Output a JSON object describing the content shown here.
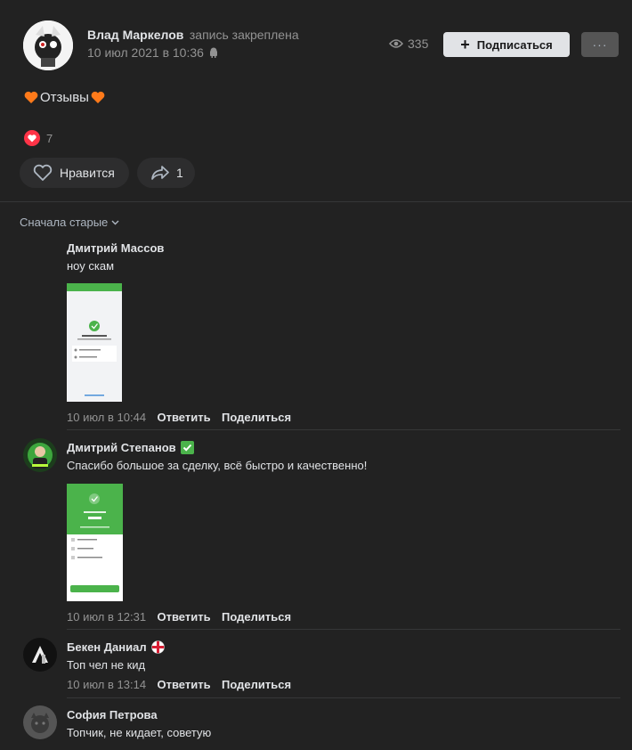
{
  "post": {
    "author": "Влад Маркелов",
    "pinned_label": "запись закреплена",
    "date": "10 июл 2021 в 10:36",
    "views": "335",
    "subscribe_label": "Подписаться",
    "text": "Отзывы",
    "reactions_count": "7",
    "like_label": "Нравится",
    "share_count": "1"
  },
  "comments_sort": {
    "label": "Сначала старые"
  },
  "comments": [
    {
      "name": "Дмитрий Массов",
      "text": "ноу скам",
      "date": "10 июл в 10:44",
      "reply": "Ответить",
      "share": "Поделиться"
    },
    {
      "name": "Дмитрий Степанов",
      "badge": "✅",
      "text": "Спасибо большое за сделку, всё быстро и качественно!",
      "date": "10 июл в 12:31",
      "reply": "Ответить",
      "share": "Поделиться"
    },
    {
      "name": "Бекен Даниал",
      "text": "Топ чел не кид",
      "date": "10 июл в 13:14",
      "reply": "Ответить",
      "share": "Поделиться"
    },
    {
      "name": "София Петрова",
      "text": "Топчик, не кидает, советую"
    }
  ],
  "colors": {
    "background": "#222222",
    "green": "#4bb34b",
    "heart": "#ff3347",
    "orange_heart": "#ff7a1a"
  }
}
